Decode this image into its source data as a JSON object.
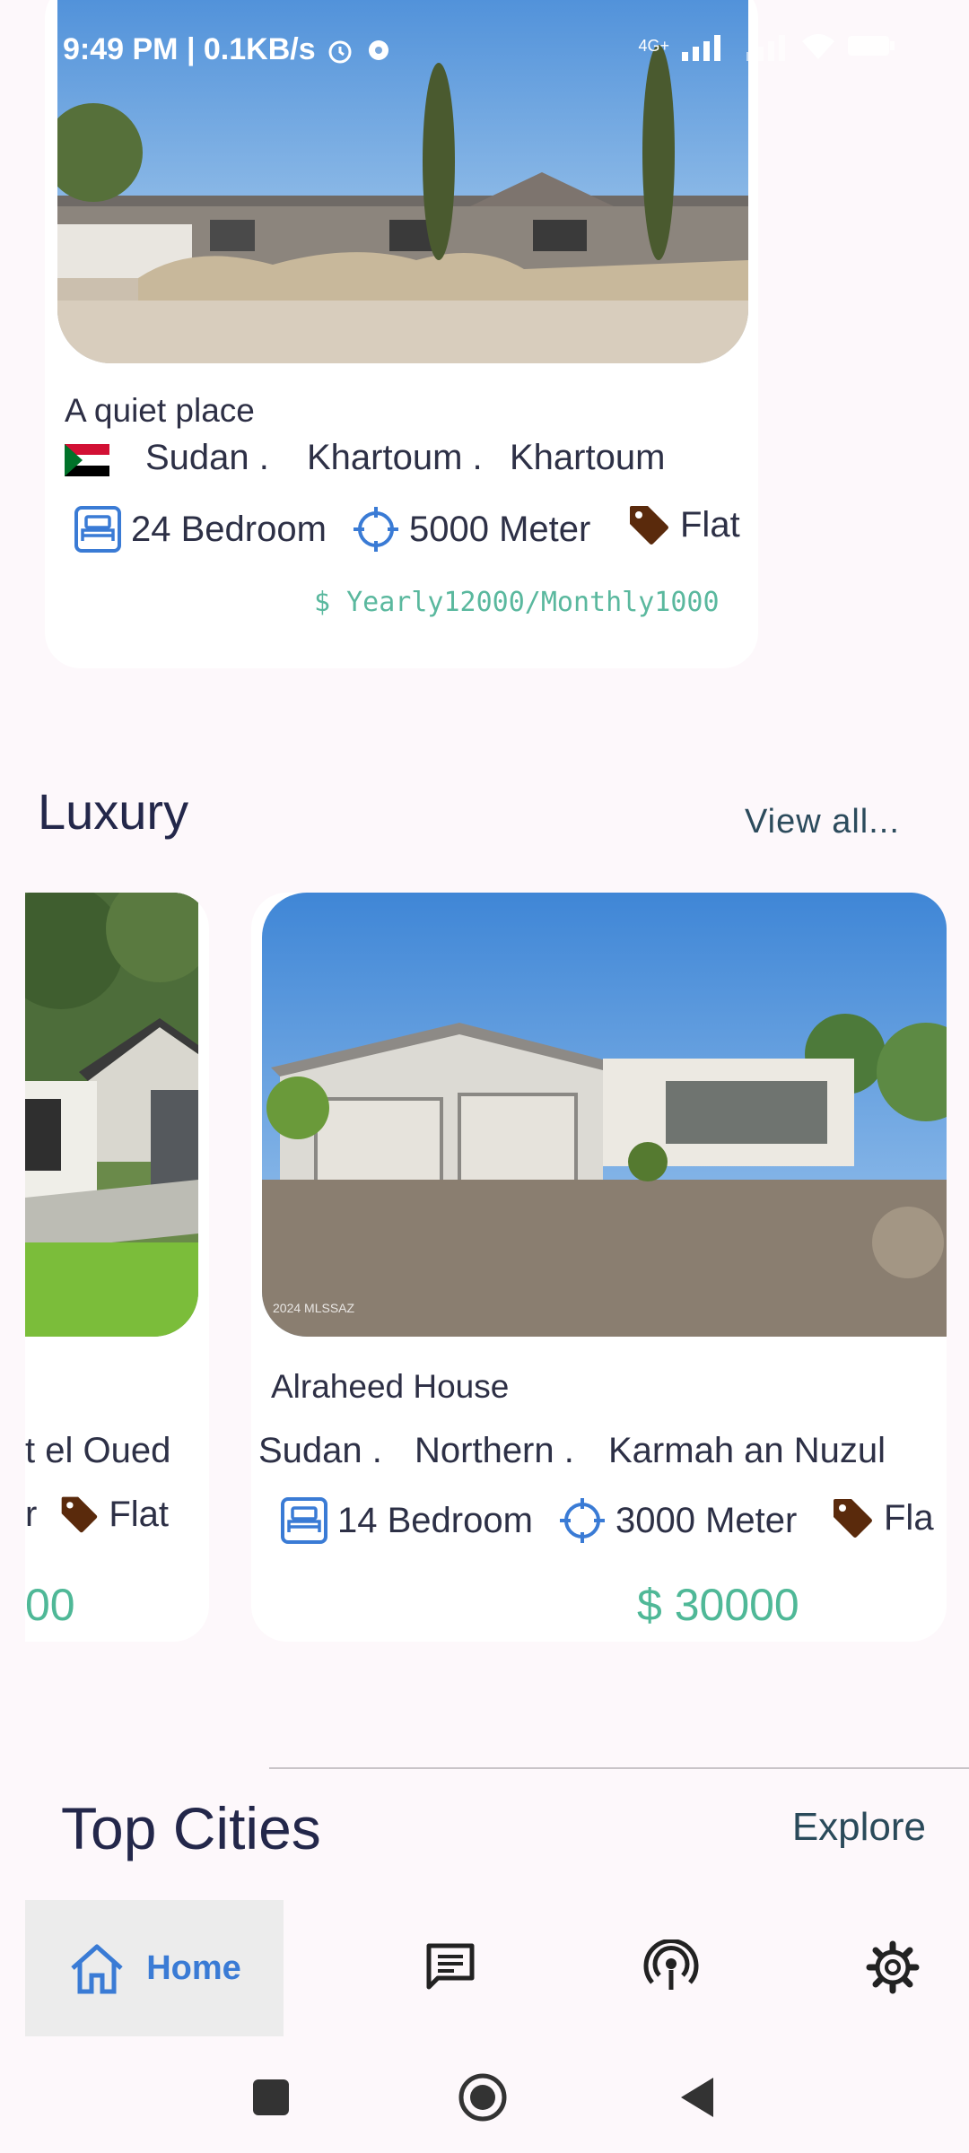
{
  "status_bar": {
    "time_text": "9:49 PM | 0.1KB/s",
    "network": "4G+"
  },
  "featured_card": {
    "title": "A quiet place",
    "country": "Sudan .",
    "state": "Khartoum .",
    "city": "Khartoum",
    "bedrooms": "24 Bedroom",
    "area": "5000 Meter",
    "type": "Flat",
    "price": "$ Yearly12000/Monthly1000"
  },
  "luxury": {
    "title": "Luxury",
    "view_all": "View all...",
    "cards": [
      {
        "city": "t el Oued",
        "bedroom_fragment": "r",
        "type": "Flat",
        "price": "00"
      },
      {
        "title": "Alraheed House",
        "country": "Sudan .",
        "state": "Northern .",
        "city": "Karmah an Nuzul",
        "bedrooms": "14 Bedroom",
        "area": "3000 Meter",
        "type": "Fla",
        "price": "$ 30000",
        "watermark": "2024 MLSSAZ"
      }
    ]
  },
  "top_cities": {
    "title": "Top Cities",
    "explore": "Explore"
  },
  "bottom_nav": {
    "home": "Home"
  },
  "colors": {
    "accent": "#3a7bd5",
    "price": "#4fb897",
    "tag": "#5a2a0c"
  }
}
